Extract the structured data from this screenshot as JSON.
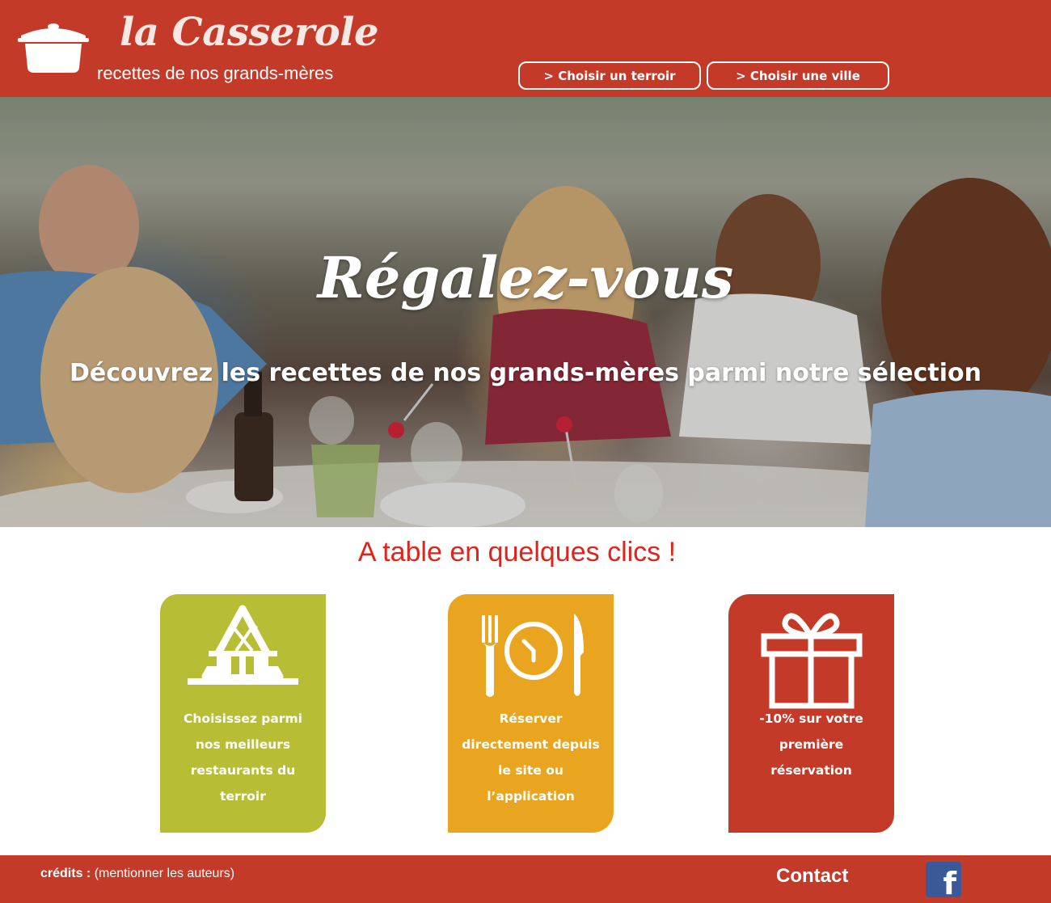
{
  "header": {
    "logo_title": "la Casserole",
    "logo_subtitle": "recettes de nos grands-mères",
    "nav": [
      {
        "label": "> Choisir un terroir"
      },
      {
        "label": "> Choisir une ville"
      }
    ]
  },
  "hero": {
    "title": "Régalez-vous",
    "subtitle": "Découvrez les recettes de nos grands-mères parmi notre sélection"
  },
  "section": {
    "title": "A table en quelques clics !"
  },
  "cards": [
    {
      "icon": "restaurant-icon",
      "text": "Choisissez parmi nos meilleurs restaurants du terroir",
      "color": "#b7bd35"
    },
    {
      "icon": "clock-cutlery-icon",
      "text": "Réserver directement depuis le site ou l’application",
      "color": "#eaa520"
    },
    {
      "icon": "gift-icon",
      "text": "-10% sur votre première réservation",
      "color": "#c33a29"
    }
  ],
  "footer": {
    "credits_label": "crédits :",
    "credits_text": " (mentionner les auteurs)",
    "contact": "Contact",
    "social_icon": "facebook-icon",
    "social_glyph": "f"
  },
  "colors": {
    "brand_red": "#c33a29",
    "accent_red_text": "#e0231c",
    "green": "#b7bd35",
    "orange": "#eaa520"
  }
}
